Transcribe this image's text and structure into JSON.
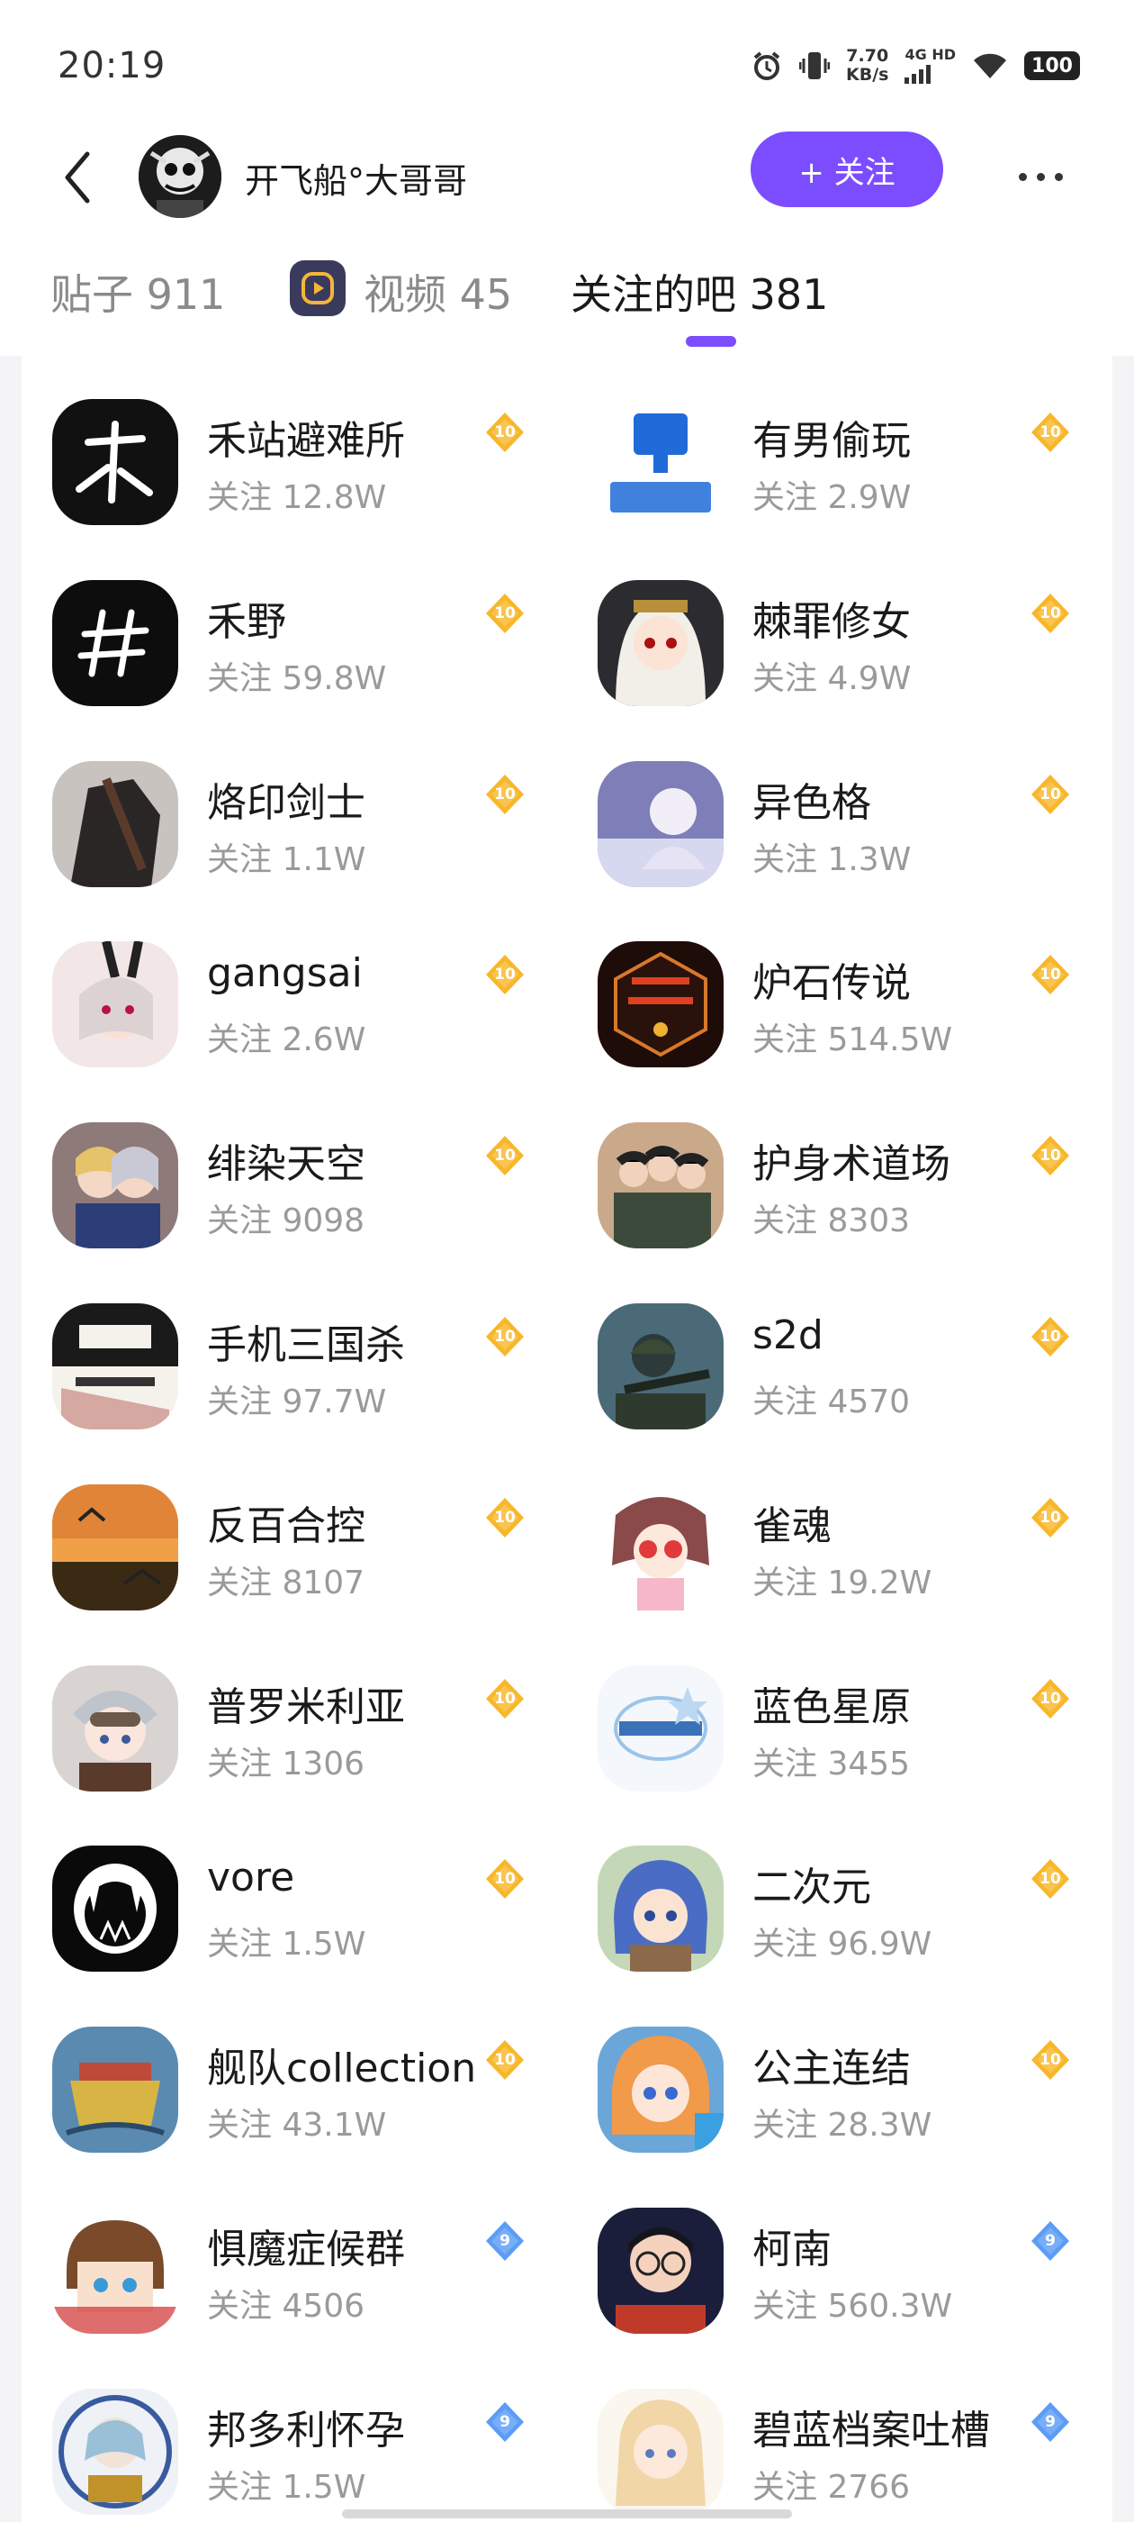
{
  "status_bar": {
    "time": "20:19",
    "speed_value": "7.70",
    "speed_unit": "KB/s",
    "network": "4G HD",
    "battery": "100"
  },
  "header": {
    "username": "开飞船°大哥哥",
    "follow_label": "+ 关注"
  },
  "tabs": [
    {
      "label": "贴子 911",
      "active": false
    },
    {
      "label": "视频 45",
      "active": false
    },
    {
      "label": "关注的吧 381",
      "active": true
    }
  ],
  "colors": {
    "accent": "#7b4dff",
    "level_gold": "#f8b72a",
    "level_blue": "#5b9cf6"
  },
  "forums": [
    {
      "name": "禾站避难所",
      "fans": "关注 12.8W",
      "level": "10",
      "icon": "calligraphy-he-logo"
    },
    {
      "name": "有男偷玩",
      "fans": "关注 2.9W",
      "level": "10",
      "icon": "thumbs-down-logo"
    },
    {
      "name": "禾野",
      "fans": "关注 59.8W",
      "level": "10",
      "icon": "hash-logo"
    },
    {
      "name": "棘罪修女",
      "fans": "关注 4.9W",
      "level": "10",
      "icon": "nun-avatar"
    },
    {
      "name": "烙印剑士",
      "fans": "关注 1.1W",
      "level": "10",
      "icon": "swordsman-avatar"
    },
    {
      "name": "异色格",
      "fans": "关注 1.3W",
      "level": "10",
      "icon": "anime-girl-avatar"
    },
    {
      "name": "gangsai",
      "fans": "关注 2.6W",
      "level": "10",
      "icon": "bunny-girl-avatar"
    },
    {
      "name": "炉石传说",
      "fans": "关注 514.5W",
      "level": "10",
      "icon": "hearthstone-logo"
    },
    {
      "name": "绯染天空",
      "fans": "关注 9098",
      "level": "10",
      "icon": "anime-duo-avatar"
    },
    {
      "name": "护身术道场",
      "fans": "关注 8303",
      "level": "10",
      "icon": "group-avatar"
    },
    {
      "name": "手机三国杀",
      "fans": "关注 97.7W",
      "level": "10",
      "icon": "sanguosha-logo"
    },
    {
      "name": "s2d",
      "fans": "关注 4570",
      "level": "10",
      "icon": "soldier-avatar"
    },
    {
      "name": "反百合控",
      "fans": "关注 8107",
      "level": "10",
      "icon": "sunset-avatar"
    },
    {
      "name": "雀魂",
      "fans": "关注 19.2W",
      "level": "10",
      "icon": "mahjong-girl-avatar"
    },
    {
      "name": "普罗米利亚",
      "fans": "关注 1306",
      "level": "10",
      "icon": "pilot-girl-avatar"
    },
    {
      "name": "蓝色星原",
      "fans": "关注 3455",
      "level": "10",
      "icon": "blue-star-logo"
    },
    {
      "name": "vore",
      "fans": "关注 1.5W",
      "level": "10",
      "icon": "fangs-logo"
    },
    {
      "name": "二次元",
      "fans": "关注 96.9W",
      "level": "10",
      "icon": "blue-hair-avatar"
    },
    {
      "name": "舰队collection",
      "fans": "关注 43.1W",
      "level": "10",
      "icon": "kancolle-logo"
    },
    {
      "name": "公主连结",
      "fans": "关注 28.3W",
      "level": "10",
      "icon": "princess-avatar"
    },
    {
      "name": "惧魔症候群",
      "fans": "关注 4506",
      "level": "9",
      "icon": "chibi-avatar"
    },
    {
      "name": "柯南",
      "fans": "关注 560.3W",
      "level": "9",
      "icon": "conan-avatar"
    },
    {
      "name": "邦多利怀孕",
      "fans": "关注 1.5W",
      "level": "9",
      "icon": "bandori-logo"
    },
    {
      "name": "碧蓝档案吐槽",
      "fans": "关注 2766",
      "level": "9",
      "icon": "blue-archive-avatar"
    }
  ]
}
